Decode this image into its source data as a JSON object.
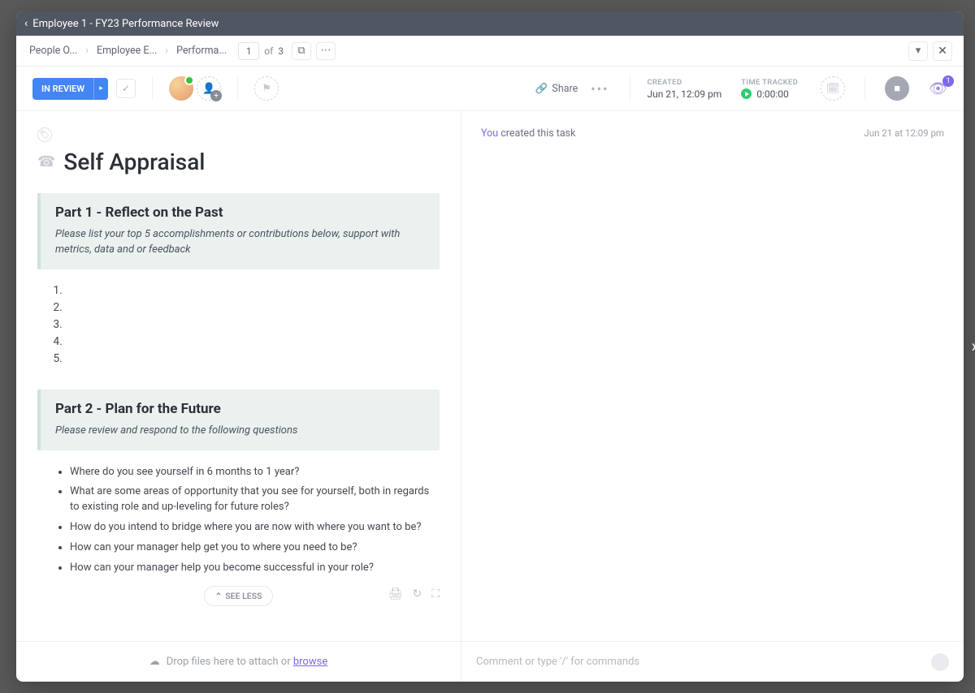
{
  "title": "Employee 1 - FY23 Performance Review",
  "breadcrumbs": {
    "b1": "People O...",
    "b2": "Employee E...",
    "b3": "Performa...",
    "page": "1",
    "of": "of",
    "total": "3"
  },
  "status": {
    "label": "IN REVIEW"
  },
  "share_label": "Share",
  "created": {
    "label": "CREATED",
    "value": "Jun 21, 12:09 pm"
  },
  "time_tracked": {
    "label": "TIME TRACKED",
    "value": "0:00:00"
  },
  "watchers": "1",
  "task_title": "Self Appraisal",
  "part1": {
    "heading": "Part 1 - Reflect on the Past",
    "prompt": "Please list your top 5 accomplishments or contributions below, support with metrics, data and or feedback"
  },
  "part2": {
    "heading": "Part 2 - Plan for the Future",
    "prompt": "Please review and respond to the following questions",
    "q1": "Where do you see yourself in 6 months to 1 year?",
    "q2": " What are some areas of opportunity that you see for yourself, both in regards to existing role and up-leveling for future roles?",
    "q3": " How do you intend to bridge where you are now with where you want to be?",
    "q4": " How can your manager help get you to where you need to be?",
    "q5": " How can your manager help you become successful in your role?"
  },
  "see_less": "SEE LESS",
  "activity": {
    "you": "You",
    "text": " created this task",
    "time": "Jun 21 at 12:09 pm"
  },
  "footer": {
    "drop_text": "Drop files here to attach or ",
    "browse": "browse",
    "comment_placeholder": "Comment or type '/' for commands"
  }
}
